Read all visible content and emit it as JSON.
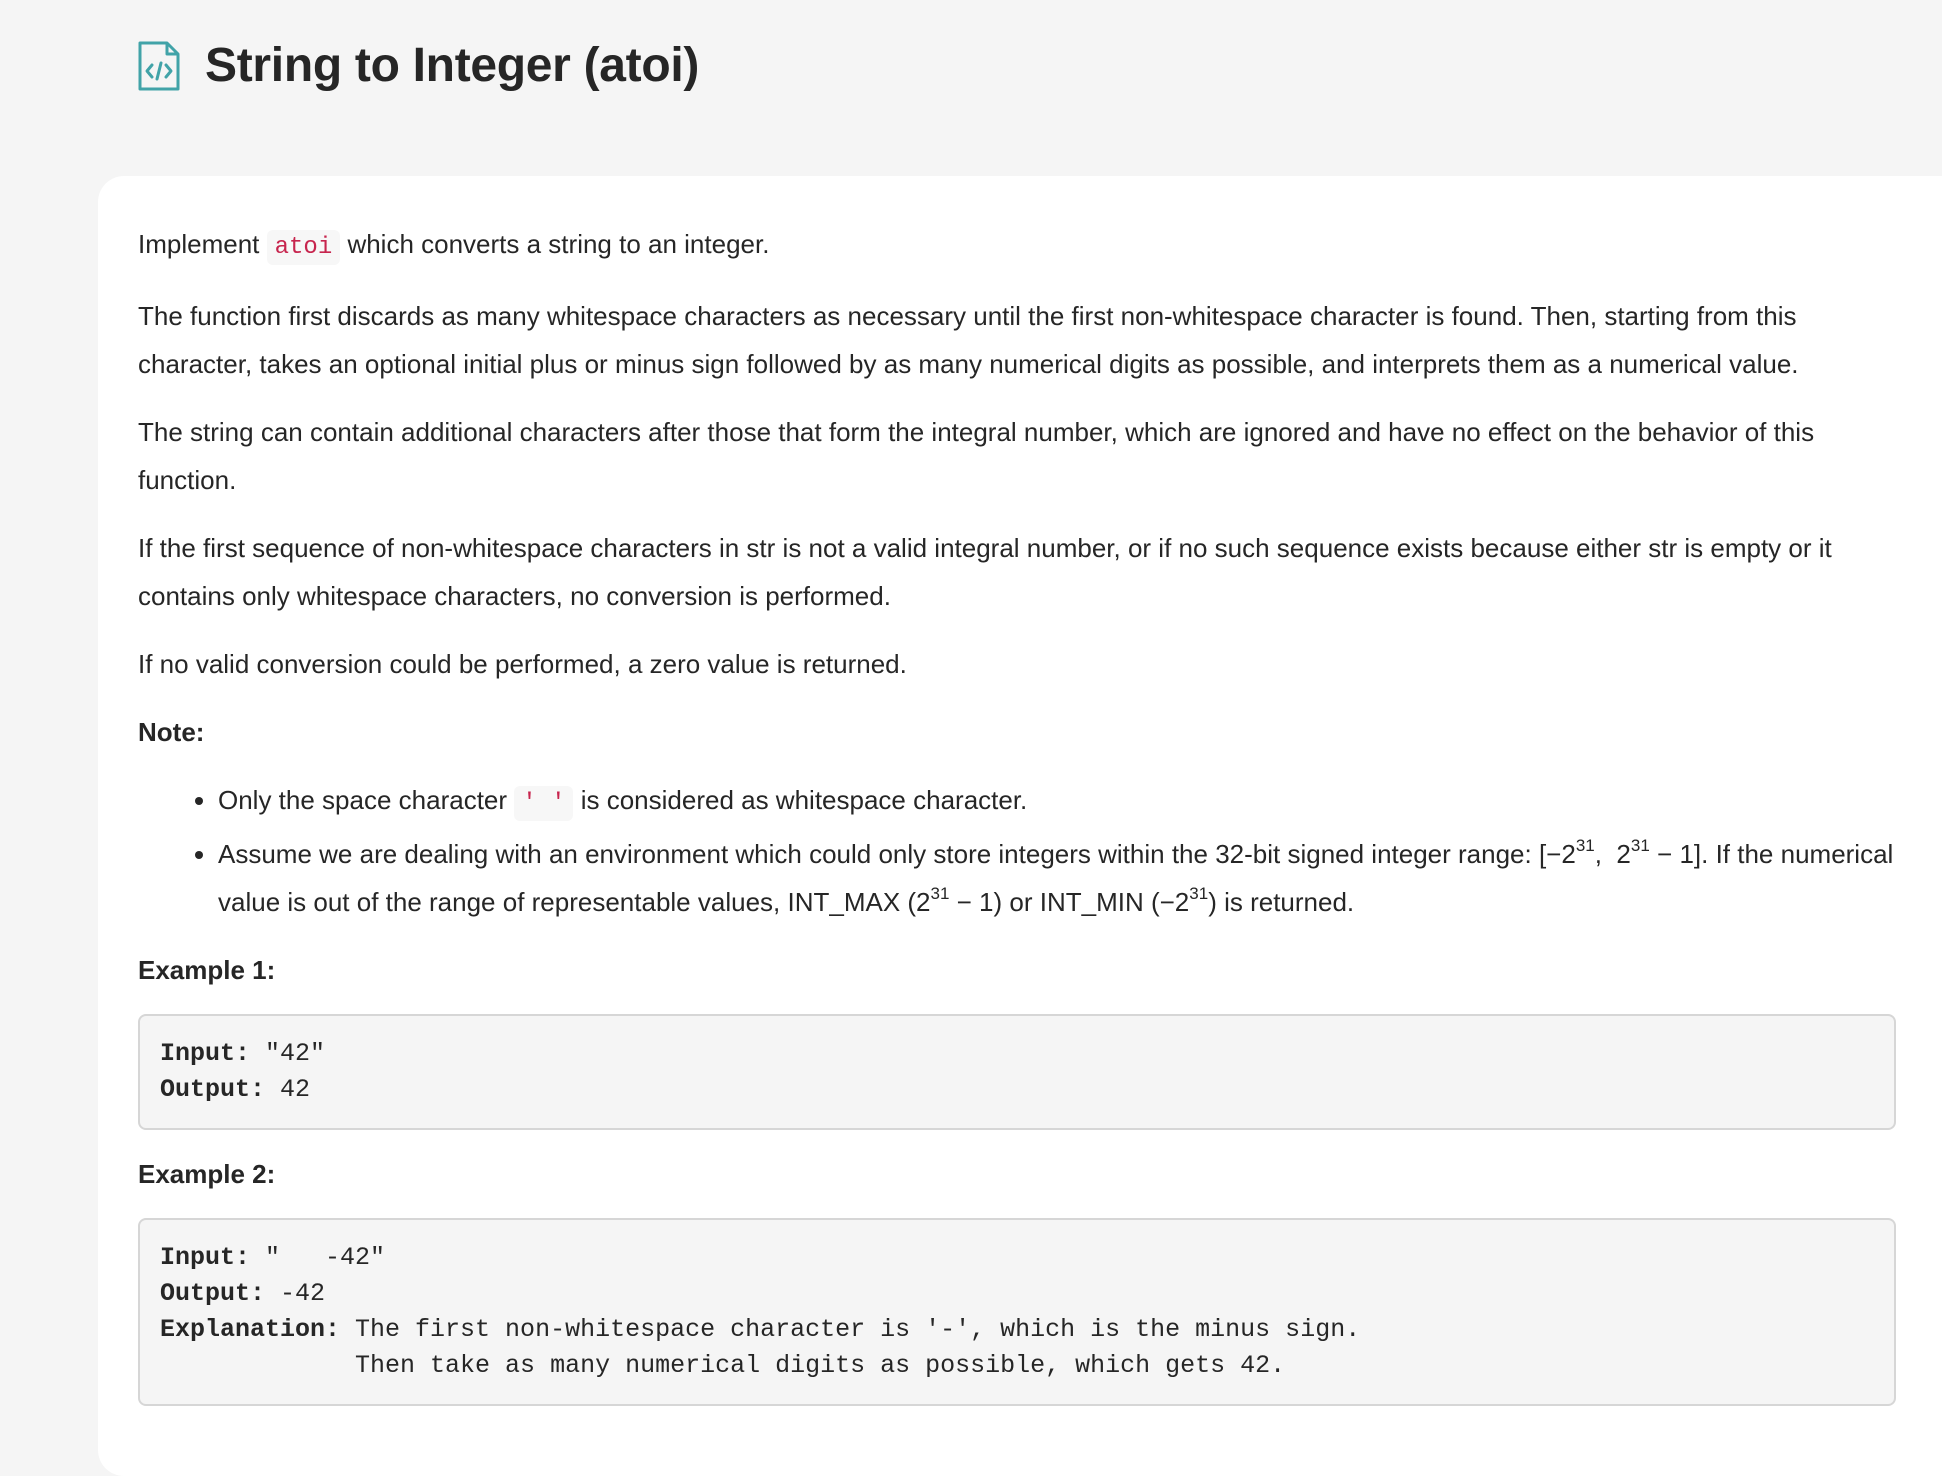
{
  "header": {
    "icon": "file-code-icon",
    "title": "String to Integer (atoi)",
    "accent_color": "#41a3a8"
  },
  "intro": {
    "before": "Implement ",
    "code": "atoi",
    "after": " which converts a string to an integer."
  },
  "paragraphs": [
    "The function first discards as many whitespace characters as necessary until the first non-whitespace character is found. Then, starting from this character, takes an optional initial plus or minus sign followed by as many numerical digits as possible, and interprets them as a numerical value.",
    "The string can contain additional characters after those that form the integral number, which are ignored and have no effect on the behavior of this function.",
    "If the first sequence of non-whitespace characters in str is not a valid integral number, or if no such sequence exists because either str is empty or it contains only whitespace characters, no conversion is performed.",
    "If no valid conversion could be performed, a zero value is returned."
  ],
  "note": {
    "heading": "Note:",
    "item1": {
      "before": "Only the space character ",
      "code": "' '",
      "after": " is considered as whitespace character."
    },
    "item2": {
      "t1": "Assume we are dealing with an environment which could only store integers within the 32-bit signed integer range: [−2",
      "s1": "31",
      "t2": ",  2",
      "s2": "31",
      "t3": " − 1]. If the numerical value is out of the range of representable values, INT_MAX (2",
      "s3": "31",
      "t4": " − 1) or INT_MIN (−2",
      "s4": "31",
      "t5": ") is returned."
    }
  },
  "examples": [
    {
      "heading": "Example 1:",
      "input_label": "Input:",
      "input_value": " \"42\"",
      "output_label": "Output:",
      "output_value": " 42"
    },
    {
      "heading": "Example 2:",
      "input_label": "Input:",
      "input_value": " \"   -42\"",
      "output_label": "Output:",
      "output_value": " -42",
      "explanation_label": "Explanation:",
      "explanation_line1": " The first non-whitespace character is '-', which is the minus sign.",
      "explanation_line2": "             Then take as many numerical digits as possible, which gets 42."
    }
  ]
}
